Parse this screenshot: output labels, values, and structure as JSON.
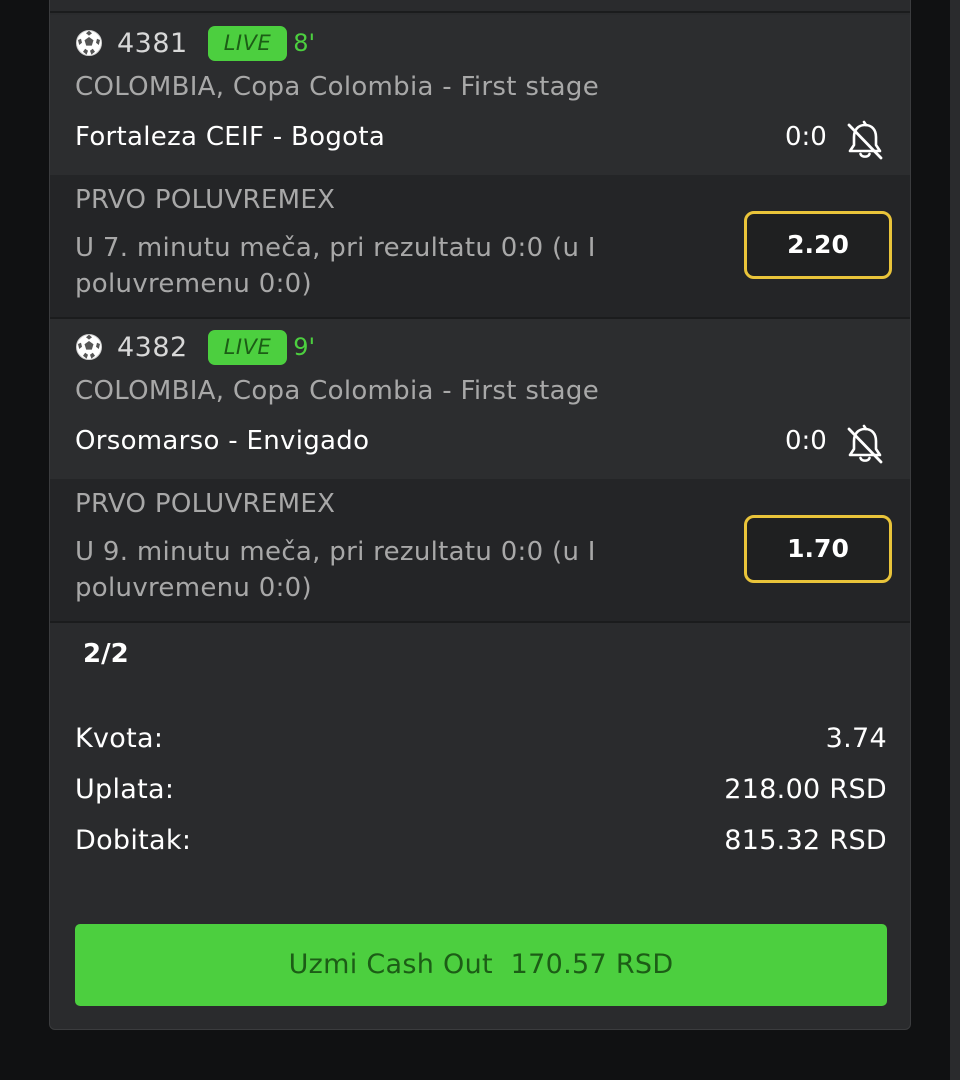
{
  "matches": [
    {
      "code": "4381",
      "live_label": "LIVE",
      "minute": "8'",
      "league": "COLOMBIA, Copa Colombia - First stage",
      "teams": "Fortaleza CEIF - Bogota",
      "score": "0:0",
      "market": "PRVO POLUVREMEX",
      "description_line1": "U 7. minutu meča, pri rezultatu 0:0 (u I",
      "description_line2": "poluvremenu 0:0)",
      "odd": "2.20"
    },
    {
      "code": "4382",
      "live_label": "LIVE",
      "minute": "9'",
      "league": "COLOMBIA, Copa Colombia - First stage",
      "teams": "Orsomarso - Envigado",
      "score": "0:0",
      "market": "PRVO POLUVREMEX",
      "description_line1": "U 9. minutu meča, pri rezultatu 0:0 (u I",
      "description_line2": "poluvremenu 0:0)",
      "odd": "1.70"
    }
  ],
  "summary": {
    "count": "2/2",
    "kvota_label": "Kvota:",
    "kvota_value": "3.74",
    "uplata_label": "Uplata:",
    "uplata_value": "218.00 RSD",
    "dobitak_label": "Dobitak:",
    "dobitak_value": "815.32 RSD"
  },
  "cashout": {
    "label": "Uzmi Cash Out",
    "amount": "170.57 RSD"
  },
  "colors": {
    "accent_green": "#4ccf3f",
    "odd_border": "#e9c43a",
    "panel": "#2a2b2d",
    "background": "#101112"
  },
  "icons": {
    "sport": "soccer-ball-icon",
    "notification": "bell-off-icon"
  }
}
